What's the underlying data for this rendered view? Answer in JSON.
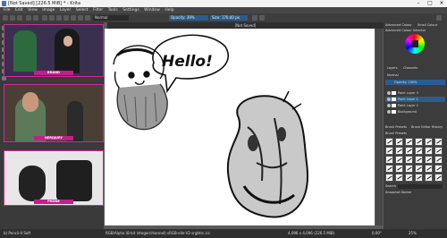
{
  "window": {
    "title": "[Not Saved] [226.5 MiB] * - Krita",
    "minimize": "–",
    "maximize": "□",
    "close": "✕"
  },
  "menu": [
    "File",
    "Edit",
    "View",
    "Image",
    "Layer",
    "Select",
    "Filter",
    "Tools",
    "Settings",
    "Window",
    "Help"
  ],
  "toolbar": {
    "blend_mode": "Normal",
    "opacity_label": "Opacity: 39%",
    "size_label": "Size: 170.00 px"
  },
  "document_tab": "[Not Saved]",
  "webcams": [
    {
      "label": "BRAND"
    },
    {
      "label": "NERDJURY"
    },
    {
      "label": "PHONE"
    }
  ],
  "dock": {
    "top_tabs": [
      "Advanced Colour",
      "Small Colour"
    ],
    "color_header": "Advanced Colour Selector",
    "panel_tabs": [
      "Layers",
      "Channels"
    ],
    "blend": "Normal",
    "opacity": "Opacity: 100%",
    "layers": [
      {
        "name": "Paint Layer 3",
        "selected": false
      },
      {
        "name": "Paint Layer 1",
        "selected": true
      },
      {
        "name": "Paint Layer 2",
        "selected": false
      },
      {
        "name": "Background",
        "selected": false
      }
    ],
    "brush_tabs": [
      "Brush Presets",
      "Brush Editor History"
    ],
    "brush_header": "Brush Presets",
    "brush_search_label": "Search",
    "snapshot_label": "Snapshot Docker"
  },
  "speech_text": "Hello!",
  "status": {
    "brush": "b) Pencil-4 Soft",
    "color_space": "RGB/Alpha (8-bit integer/channel)  sRGB-elle-V2-srgbtrc.icc",
    "dimensions": "4,096 x 4,096 (226.5 MiB)",
    "rotation": "0.00°",
    "zoom": "25%"
  },
  "colors": {
    "accent": "#2a5d8f",
    "cam_border": "#d02a9a",
    "canvas": "#ffffff"
  }
}
